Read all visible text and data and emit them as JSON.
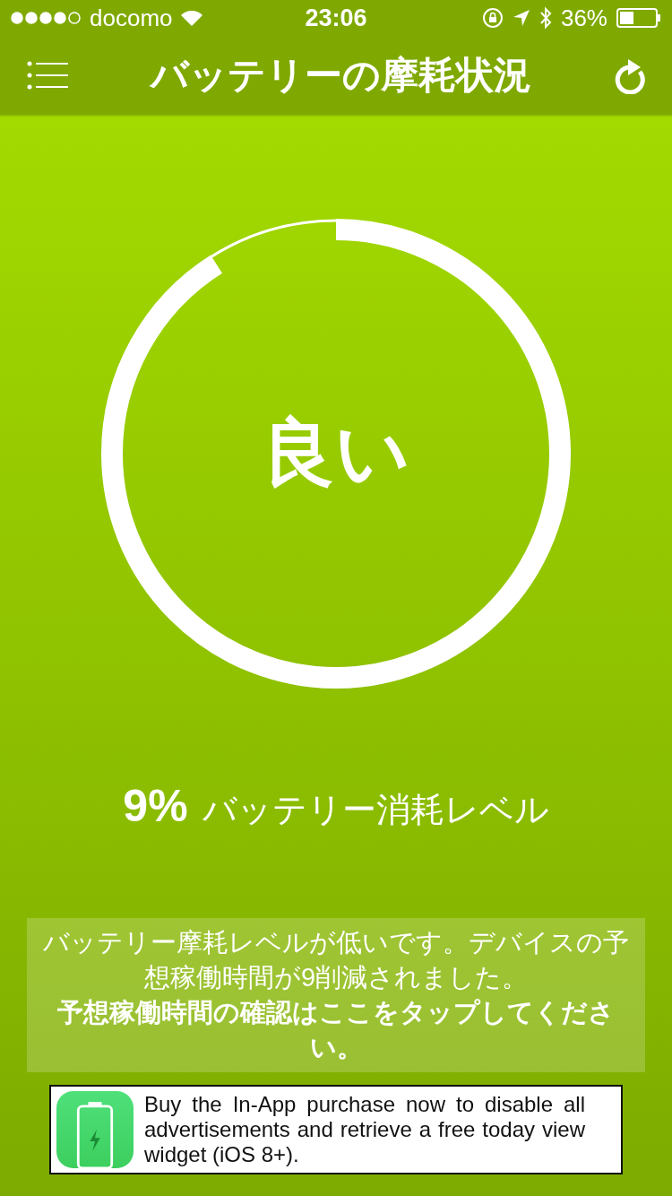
{
  "status_bar": {
    "carrier": "docomo",
    "time": "23:06",
    "battery": "36%"
  },
  "nav": {
    "title": "バッテリーの摩耗状況"
  },
  "gauge": {
    "level": 0.91,
    "status": "良い"
  },
  "wear": {
    "percent": "9%",
    "label": "バッテリー消耗レベル"
  },
  "message": {
    "text": "バッテリー摩耗レベルが低いです。デバイスの予想稼働時間が9削減されました。",
    "action": "予想稼働時間の確認はここをタップしてください。"
  },
  "ad": {
    "text": "Buy the In-App purchase now to disable all advertisements and retrieve a free today view widget (iOS 8+)."
  }
}
